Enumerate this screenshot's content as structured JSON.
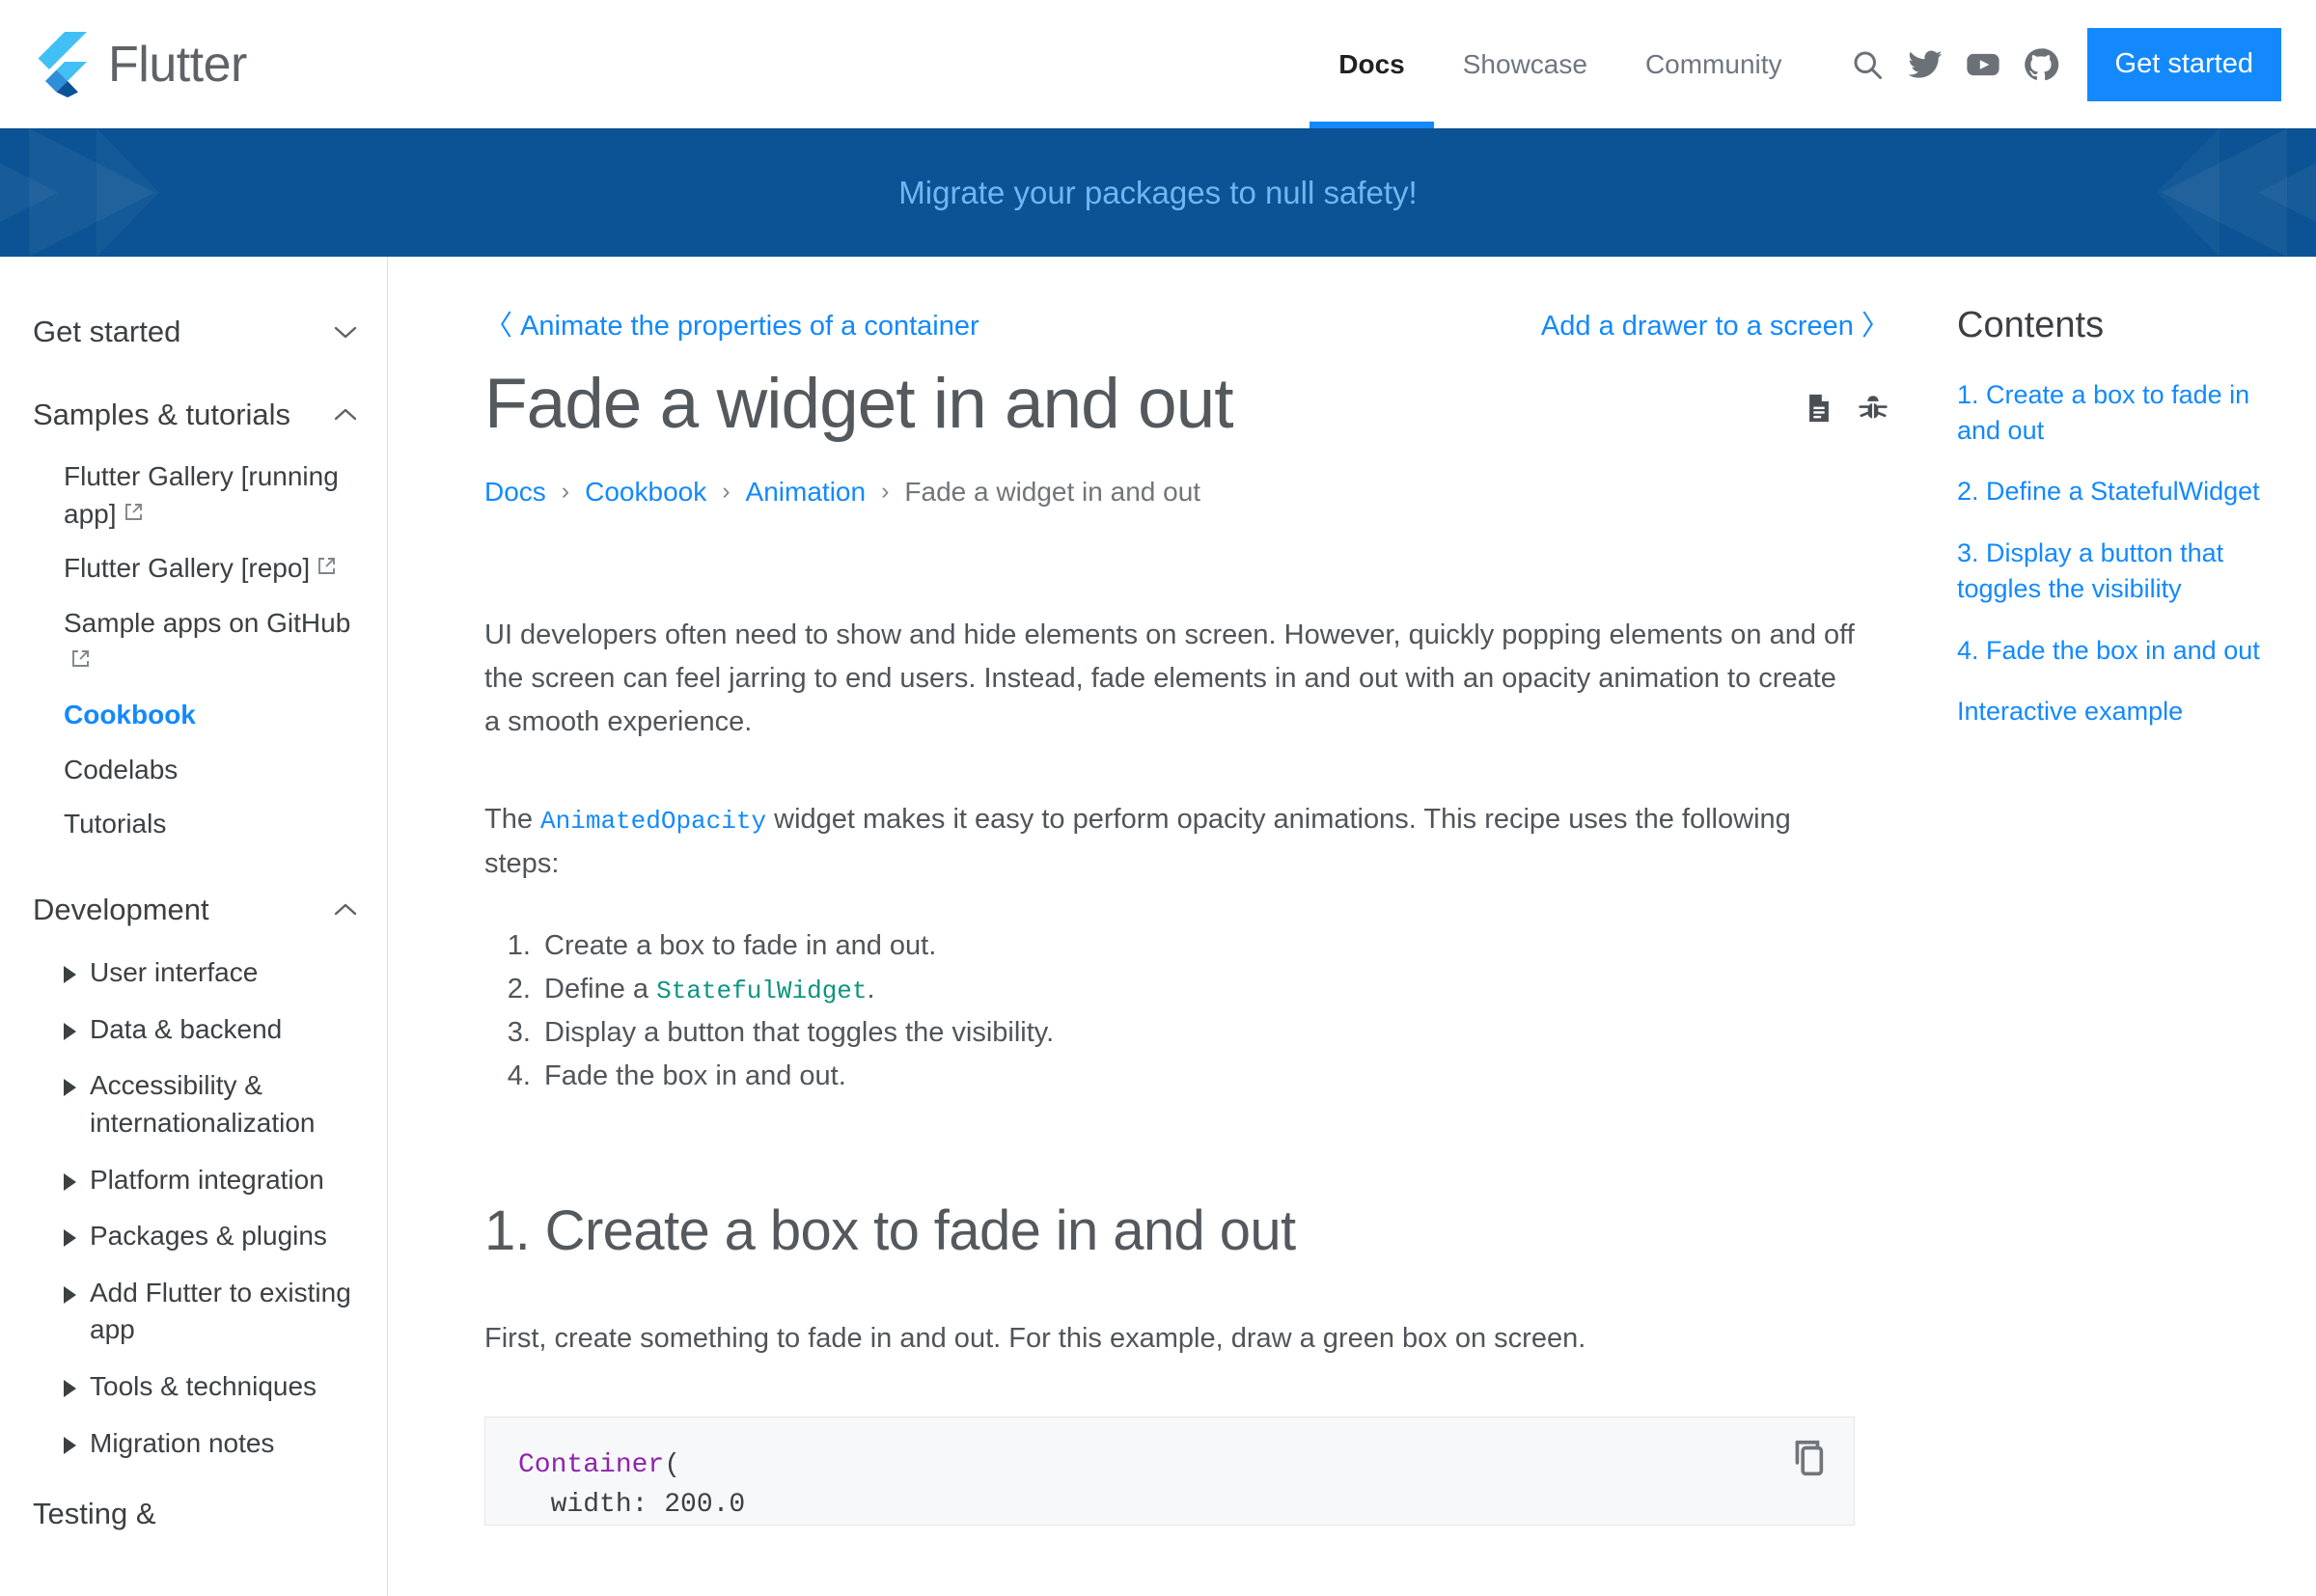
{
  "header": {
    "brand": "Flutter",
    "nav": [
      {
        "label": "Docs",
        "active": true
      },
      {
        "label": "Showcase",
        "active": false
      },
      {
        "label": "Community",
        "active": false
      }
    ],
    "icons": [
      "search-icon",
      "twitter-icon",
      "youtube-icon",
      "github-icon"
    ],
    "cta_label": "Get started",
    "accent_color": "#1389fd"
  },
  "banner": {
    "text": "Migrate your packages to null safety!",
    "bg_color": "#0b5394",
    "text_color": "#6fb7f2"
  },
  "sidebar": {
    "groups": [
      {
        "title": "Get started",
        "state": "collapsed"
      },
      {
        "title": "Samples & tutorials",
        "state": "expanded",
        "items": [
          {
            "label": "Flutter Gallery [running app]",
            "external": true,
            "current": false
          },
          {
            "label": "Flutter Gallery [repo]",
            "external": true,
            "current": false
          },
          {
            "label": "Sample apps on GitHub",
            "external": true,
            "current": false
          },
          {
            "label": "Cookbook",
            "external": false,
            "current": true
          },
          {
            "label": "Codelabs",
            "external": false,
            "current": false
          },
          {
            "label": "Tutorials",
            "external": false,
            "current": false
          }
        ]
      },
      {
        "title": "Development",
        "state": "expanded",
        "items": [
          {
            "label": "User interface",
            "caret": true
          },
          {
            "label": "Data & backend",
            "caret": true
          },
          {
            "label": "Accessibility & internationalization",
            "caret": true
          },
          {
            "label": "Platform integration",
            "caret": true
          },
          {
            "label": "Packages & plugins",
            "caret": true
          },
          {
            "label": "Add Flutter to existing app",
            "caret": true
          },
          {
            "label": "Tools & techniques",
            "caret": true
          },
          {
            "label": "Migration notes",
            "caret": true
          }
        ]
      },
      {
        "title": "Testing &",
        "state": "partial"
      }
    ]
  },
  "main": {
    "prev_label": "Animate the properties of a container",
    "prev_arrow": "〈",
    "next_label": "Add a drawer to a screen",
    "next_arrow": "〉",
    "title": "Fade a widget in and out",
    "title_icons": [
      "document-icon",
      "bug-icon"
    ],
    "breadcrumb": [
      {
        "label": "Docs",
        "current": false
      },
      {
        "label": "Cookbook",
        "current": false
      },
      {
        "label": "Animation",
        "current": false
      },
      {
        "label": "Fade a widget in and out",
        "current": true
      }
    ],
    "breadcrumb_sep": "›",
    "intro_p1": "UI developers often need to show and hide elements on screen. However, quickly popping elements on and off the screen can feel jarring to end users. Instead, fade elements in and out with an opacity animation to create a smooth experience.",
    "intro_p2_before": "The ",
    "intro_p2_code": "AnimatedOpacity",
    "intro_p2_after": " widget makes it easy to perform opacity animations. This recipe uses the following steps:",
    "steps": [
      {
        "text": "Create a box to fade in and out.",
        "code": "",
        "tail": ""
      },
      {
        "text": "Define a ",
        "code": "StatefulWidget",
        "tail": "."
      },
      {
        "text": "Display a button that toggles the visibility.",
        "code": "",
        "tail": ""
      },
      {
        "text": "Fade the box in and out.",
        "code": "",
        "tail": ""
      }
    ],
    "section_heading": "1. Create a box to fade in and out",
    "section_para": "First, create something to fade in and out. For this example, draw a green box on screen.",
    "code": {
      "line1_token": "Container",
      "line1_rest": "(",
      "line2": "  width: 200.0",
      "copy_icon": "copy-icon"
    }
  },
  "toc": {
    "title": "Contents",
    "links": [
      "1. Create a box to fade in and out",
      "2. Define a StatefulWidget",
      "3. Display a button that toggles the visibility",
      "4. Fade the box in and out",
      "Interactive example"
    ]
  }
}
